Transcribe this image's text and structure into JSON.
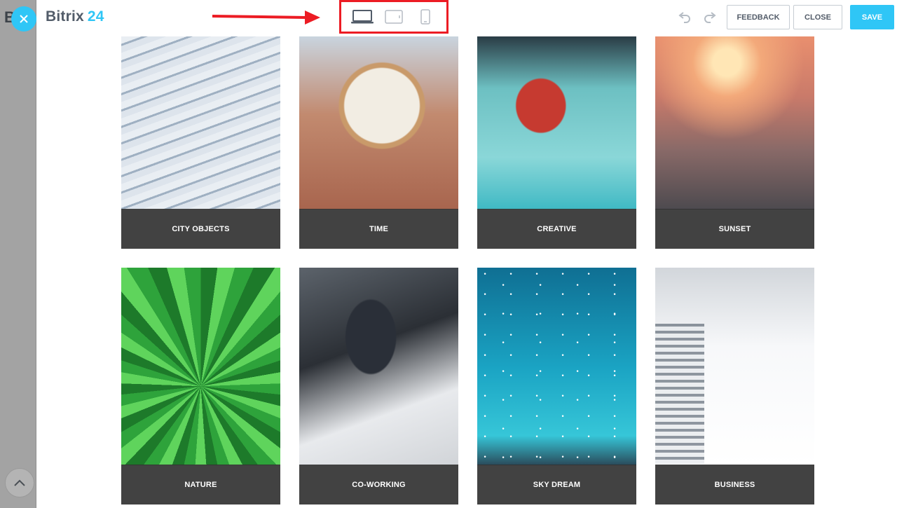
{
  "backdrop": {
    "letter": "B"
  },
  "header": {
    "logo_text": "Bitrix",
    "logo_number": "24",
    "buttons": {
      "feedback": "FEEDBACK",
      "close": "CLOSE",
      "save": "SAVE"
    },
    "device_modes": [
      "desktop-icon",
      "tablet-icon",
      "mobile-icon"
    ],
    "selected_device": "desktop"
  },
  "colors": {
    "accent": "#2fc6f6",
    "highlight_box": "#ec1c24",
    "caption_bg": "#323232"
  },
  "gallery": {
    "tiles": [
      {
        "caption": "CITY OBJECTS"
      },
      {
        "caption": "TIME"
      },
      {
        "caption": "CREATIVE"
      },
      {
        "caption": "SUNSET"
      },
      {
        "caption": "NATURE"
      },
      {
        "caption": "CO-WORKING"
      },
      {
        "caption": "SKY DREAM"
      },
      {
        "caption": "BUSINESS"
      }
    ]
  }
}
